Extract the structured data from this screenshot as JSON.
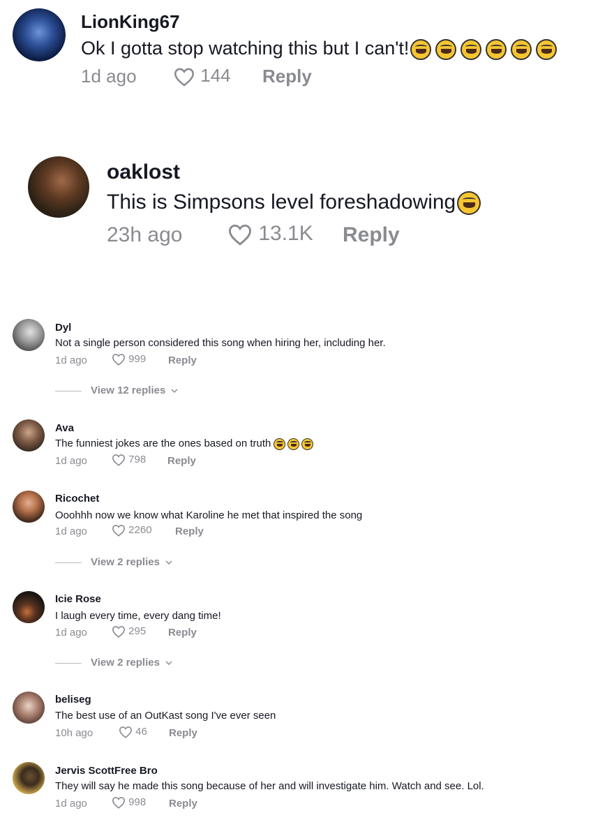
{
  "comments": [
    {
      "username": "LionKing67",
      "text": "Ok I gotta stop watching this but I can't!",
      "time": "1d ago",
      "likes": "144",
      "reply": "Reply"
    },
    {
      "username": "oaklost",
      "text": "This is Simpsons level foreshadowing",
      "time": "23h ago",
      "likes": "13.1K",
      "reply": "Reply"
    },
    {
      "username": "Dyl",
      "text": "Not a single person considered this song when hiring her, including her.",
      "time": "1d ago",
      "likes": "999",
      "reply": "Reply",
      "view_replies": "View 12 replies"
    },
    {
      "username": "Ava",
      "text": "The funniest jokes are the ones based on truth",
      "time": "1d ago",
      "likes": "798",
      "reply": "Reply"
    },
    {
      "username": "Ricochet",
      "text": "Ooohhh now we know what Karoline he met that inspired the song",
      "time": "1d ago",
      "likes": "2260",
      "reply": "Reply",
      "view_replies": "View 2 replies"
    },
    {
      "username": "Icie Rose",
      "text": "I laugh every time, every dang time!",
      "time": "1d ago",
      "likes": "295",
      "reply": "Reply",
      "view_replies": "View 2 replies"
    },
    {
      "username": "beliseg",
      "text": "The best use of an OutKast song I've ever seen",
      "time": "10h ago",
      "likes": "46",
      "reply": "Reply"
    },
    {
      "username": "Jervis ScottFree Bro",
      "text": "They will say he made this song because of her and will investigate him. Watch and see. Lol.",
      "time": "1d ago",
      "likes": "998",
      "reply": "Reply"
    }
  ],
  "icons": {
    "like": "heart-outline-icon",
    "chevron": "chevron-down-icon",
    "emoji_laugh": "rolling-laughing-emoji",
    "emoji_grin": "grinning-squint-emoji"
  },
  "colors": {
    "meta": "#8a8b91",
    "text": "#161823"
  }
}
